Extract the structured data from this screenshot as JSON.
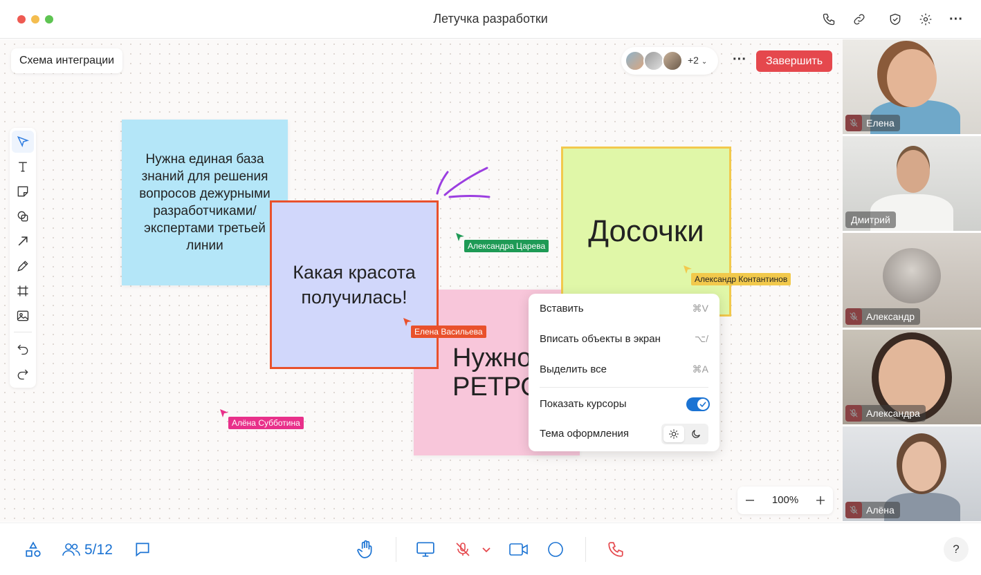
{
  "window": {
    "title": "Летучка разработки"
  },
  "board": {
    "name": "Схема интеграции"
  },
  "participants_header": {
    "more_count": "+2",
    "finish_label": "Завершить"
  },
  "stickies": {
    "blue": "Нужна единая база знаний для решения вопросов дежурными разработчиками/ экспертами третьей линии",
    "purple": "Какая красота получилась!",
    "pink": "Нужно РЕТРО",
    "green": "Досочки"
  },
  "cursors": {
    "c1": {
      "name": "Александра Царева",
      "color": "#1e9a55"
    },
    "c2": {
      "name": "Александр Контантинов",
      "color": "#f2c94c"
    },
    "c3": {
      "name": "Елена Васильева",
      "color": "#e9512c"
    },
    "c4": {
      "name": "Алёна Субботина",
      "color": "#e8308a"
    }
  },
  "context_menu": {
    "paste": {
      "label": "Вставить",
      "shortcut": "⌘V"
    },
    "fit": {
      "label": "Вписать объекты в экран",
      "shortcut": "⌥/"
    },
    "select_all": {
      "label": "Выделить все",
      "shortcut": "⌘A"
    },
    "show_cursors": {
      "label": "Показать курсоры",
      "enabled": true
    },
    "theme": {
      "label": "Тема оформления",
      "selected": "light"
    }
  },
  "zoom": {
    "value": "100%"
  },
  "videos": [
    {
      "name": "Елена",
      "muted": true,
      "active": false
    },
    {
      "name": "Дмитрий",
      "muted": false,
      "active": true
    },
    {
      "name": "Александр",
      "muted": true,
      "active": false
    },
    {
      "name": "Александра",
      "muted": true,
      "active": false
    },
    {
      "name": "Алёна",
      "muted": true,
      "active": false
    }
  ],
  "bottom_bar": {
    "participants_count": "5/12",
    "help_label": "?"
  },
  "colors": {
    "accent": "#1b73d3",
    "danger": "#e5484d",
    "active_tile": "#1f8cf5"
  }
}
